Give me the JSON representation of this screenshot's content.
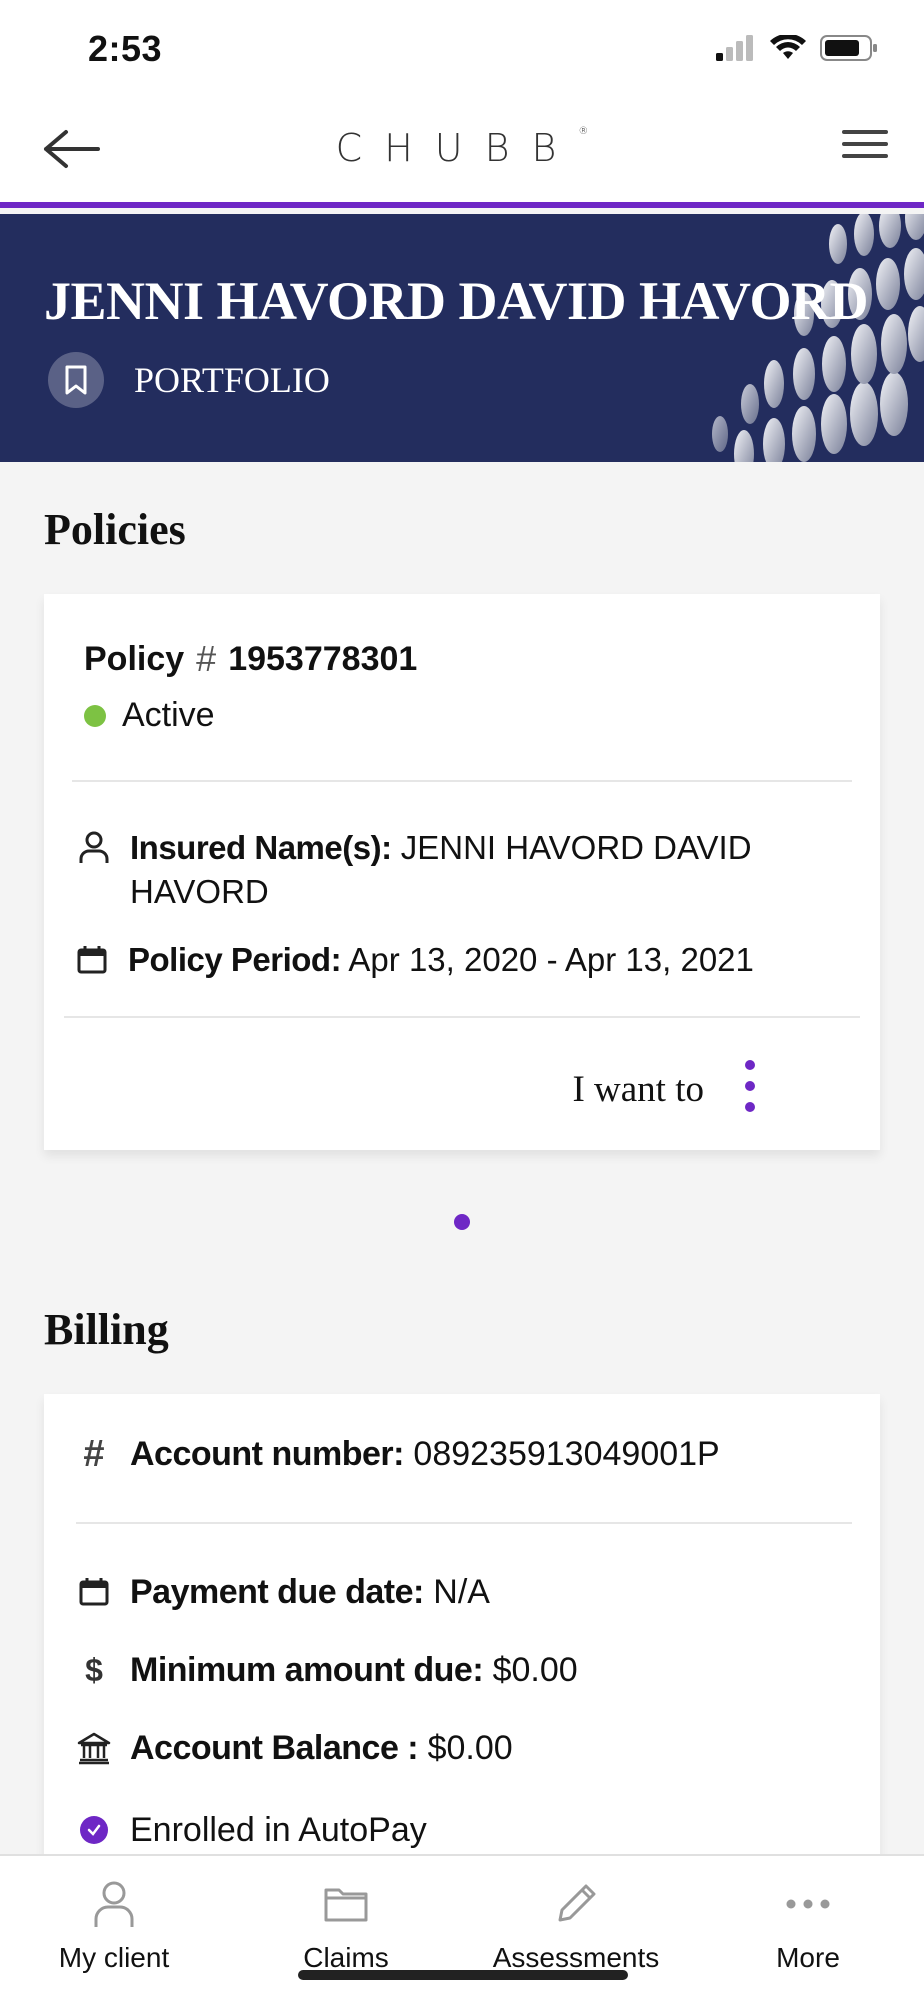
{
  "status_bar": {
    "time": "2:53"
  },
  "header": {
    "logo": "CHUBB",
    "logo_mark": "®"
  },
  "hero": {
    "title": "JENNI HAVORD DAVID HAVORD",
    "subtitle": "PORTFOLIO"
  },
  "policies": {
    "title": "Policies",
    "card": {
      "policy_label": "Policy",
      "hash": "#",
      "policy_number": "1953778301",
      "status": "Active",
      "insured_label": "Insured Name(s):",
      "insured_value": "JENNI HAVORD DAVID",
      "insured_value_2": "HAVORD",
      "period_label": "Policy Period:",
      "period_value": "Apr 13, 2020 - Apr 13, 2021",
      "action_label": "I want to"
    }
  },
  "billing": {
    "title": "Billing",
    "account_label": "Account number:",
    "account_value": "089235913049001P",
    "due_label": "Payment due date:",
    "due_value": "N/A",
    "min_label": "Minimum amount due:",
    "min_value": "$0.00",
    "balance_label": "Account Balance :",
    "balance_value": "$0.00",
    "autopay": "Enrolled in AutoPay"
  },
  "tabs": [
    {
      "label": "My client",
      "icon": "person-icon"
    },
    {
      "label": "Claims",
      "icon": "folder-icon"
    },
    {
      "label": "Assessments",
      "icon": "pencil-icon"
    },
    {
      "label": "More",
      "icon": "ellipsis-icon"
    }
  ],
  "colors": {
    "accent": "#6e27c5",
    "hero_bg": "#232d5e",
    "active": "#7dc243"
  }
}
